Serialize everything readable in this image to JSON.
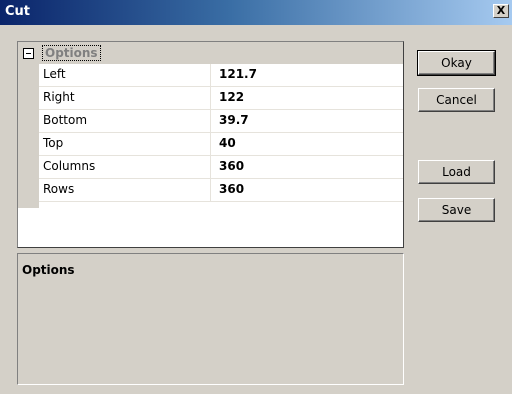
{
  "window": {
    "title": "Cut",
    "close_glyph": "X"
  },
  "property_grid": {
    "category": "Options",
    "rows": [
      {
        "name": "Left",
        "value": "121.7"
      },
      {
        "name": "Right",
        "value": "122"
      },
      {
        "name": "Bottom",
        "value": "39.7"
      },
      {
        "name": "Top",
        "value": "40"
      },
      {
        "name": "Columns",
        "value": "360"
      },
      {
        "name": "Rows",
        "value": "360"
      }
    ]
  },
  "description": {
    "title": "Options"
  },
  "buttons": {
    "okay": "Okay",
    "cancel": "Cancel",
    "load": "Load",
    "save": "Save"
  }
}
